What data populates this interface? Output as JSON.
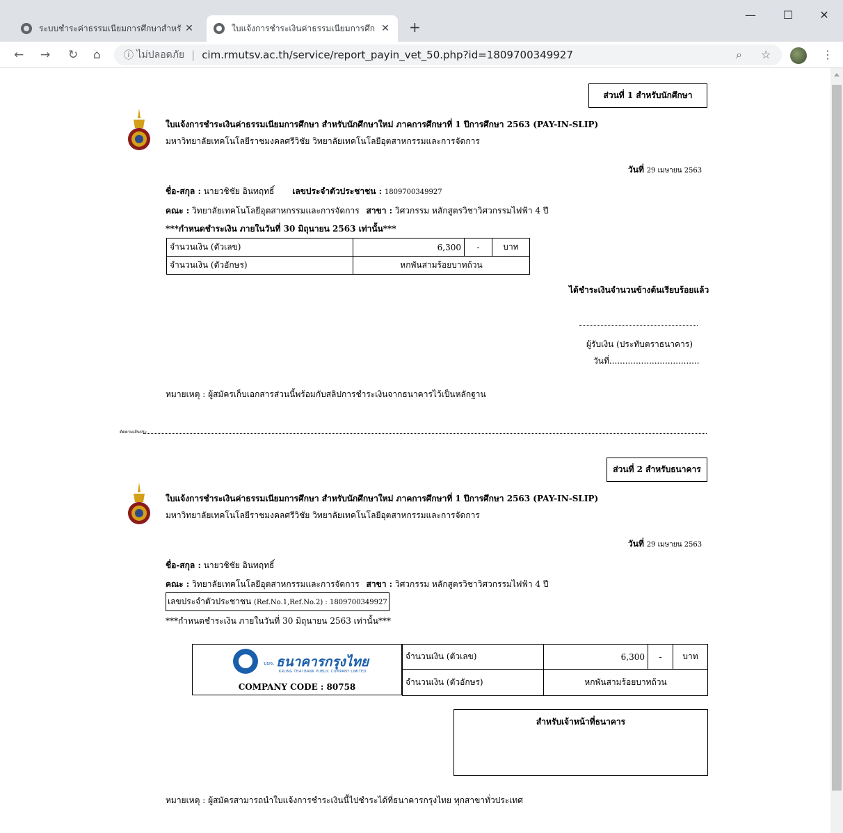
{
  "browser": {
    "tabs": [
      {
        "label": "ระบบชำระค่าธรรมเนียมการศึกษาสำหรั",
        "active": false
      },
      {
        "label": "ใบแจ้งการชำระเงินค่าธรรมเนียมการศึก",
        "active": true
      }
    ],
    "new_tab": "+",
    "url": "cim.rmutsv.ac.th/service/report_payin_vet_50.php?id=1809700349927",
    "security_label": "ไม่ปลอดภัย"
  },
  "part1": {
    "label": "ส่วนที่ 1 สำหรับนักศึกษา",
    "heading": "ใบแจ้งการชำระเงินค่าธรรมเนียมการศึกษา สำหรับนักศึกษาใหม่ ภาคการศึกษาที่ 1 ปีการศึกษา 2563 (PAY-IN-SLIP)",
    "institution": "มหาวิทยาลัยเทคโนโลยีราชมงคลศรีวิชัย วิทยาลัยเทคโนโลยีอุตสาหกรรมและการจัดการ",
    "date_label": "วันที่",
    "date_value": "29 เมษายน 2563",
    "name_label": "ชื่อ-สกุล :",
    "name_value": "นายวชิชัย อินทฤทธิ์",
    "id_label": "เลขประจำตัวประชาชน :",
    "id_value": "1809700349927",
    "faculty_label": "คณะ :",
    "faculty_value": "วิทยาลัยเทคโนโลยีอุตสาหกรรมและการจัดการ",
    "major_label": "สาขา :",
    "major_value": "วิศวกรรม หลักสูตรวิชาวิศวกรรมไฟฟ้า 4 ปี",
    "deadline": "***กำหนดชำระเงิน ภายในวันที่ 30 มิถุนายน 2563 เท่านั้น***",
    "amount_num_label": "จำนวนเงิน (ตัวเลข)",
    "amount_num": "6,300",
    "amount_dash": "-",
    "currency": "บาท",
    "amount_text_label": "จำนวนเงิน (ตัวอักษร)",
    "amount_text": "หกพันสามร้อยบาทถ้วน",
    "received": "ได้ชำระเงินจำนวนข้างต้นเรียบร้อยแล้ว",
    "receiver": "ผู้รับเงิน (ประทับตราธนาคาร)",
    "receiver_date": "วันที่..................................",
    "note": "หมายเหตุ : ผู้สมัครเก็บเอกสารส่วนนี้พร้อมกับสลิปการชำระเงินจากธนาคารไว้เป็นหลักฐาน"
  },
  "cut_label": "ตัดตามเส้นประ",
  "part2": {
    "label": "ส่วนที่ 2 สำหรับธนาคาร",
    "heading": "ใบแจ้งการชำระเงินค่าธรรมเนียมการศึกษา สำหรับนักศึกษาใหม่ ภาคการศึกษาที่ 1 ปีการศึกษา 2563 (PAY-IN-SLIP)",
    "institution": "มหาวิทยาลัยเทคโนโลยีราชมงคลศรีวิชัย วิทยาลัยเทคโนโลยีอุตสาหกรรมและการจัดการ",
    "date_label": "วันที่",
    "date_value": "29 เมษายน 2563",
    "name_label": "ชื่อ-สกุล :",
    "name_value": "นายวชิชัย อินทฤทธิ์",
    "faculty_label": "คณะ :",
    "faculty_value": "วิทยาลัยเทคโนโลยีอุตสาหกรรมและการจัดการ",
    "major_label": "สาขา :",
    "major_value": "วิศวกรรม หลักสูตรวิชาวิศวกรรมไฟฟ้า 4 ปี",
    "ref_label": "เลขประจำตัวประชาชน",
    "ref_detail": "(Ref.No.1,Ref.No.2) : 1809700349927",
    "deadline": "***กำหนดชำระเงิน ภายในวันที่ 30 มิถุนายน 2563 เท่านั้น***",
    "bank_name": "ธนาคารกรุงไทย",
    "bank_prefix": "บมจ.",
    "bank_sub": "KRUNG THAI BANK PUBLIC COMPANY LIMITED",
    "company_code": "COMPANY CODE : 80758",
    "amount_num_label": "จำนวนเงิน (ตัวเลข)",
    "amount_num": "6,300",
    "amount_dash": "-",
    "currency": "บาท",
    "amount_text_label": "จำนวนเงิน (ตัวอักษร)",
    "amount_text": "หกพันสามร้อยบาทถ้วน",
    "officer_label": "สำหรับเจ้าหน้าที่ธนาคาร",
    "note": "หมายเหตุ : ผู้สมัครสามารถนำใบแจ้งการชำระเงินนี้ไปชำระได้ที่ธนาคารกรุงไทย ทุกสาขาทั่วประเทศ"
  }
}
